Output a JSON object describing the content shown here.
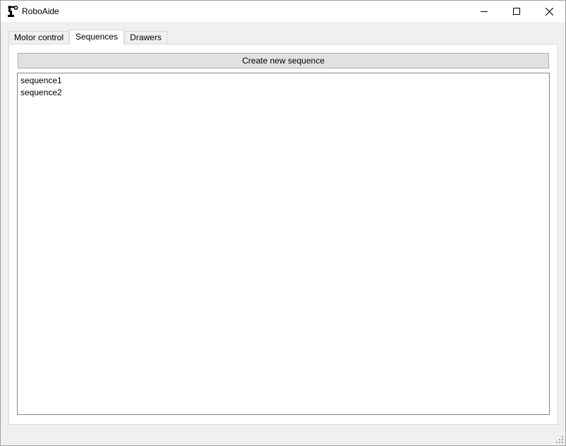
{
  "window": {
    "title": "RoboAide",
    "icon": "robot-arm-icon",
    "controls": [
      "minimize-icon",
      "maximize-icon",
      "close-icon"
    ]
  },
  "tabs": [
    {
      "label": "Motor control",
      "active": false
    },
    {
      "label": "Sequences",
      "active": true
    },
    {
      "label": "Drawers",
      "active": false
    }
  ],
  "sequences_tab": {
    "create_button_label": "Create new sequence",
    "list_items": [
      "sequence1",
      "sequence2"
    ]
  },
  "colors": {
    "window_bg": "#f0f0f0",
    "panel_bg": "#ffffff",
    "button_bg": "#e1e1e1",
    "button_border": "#adadad",
    "list_border": "#828790"
  }
}
